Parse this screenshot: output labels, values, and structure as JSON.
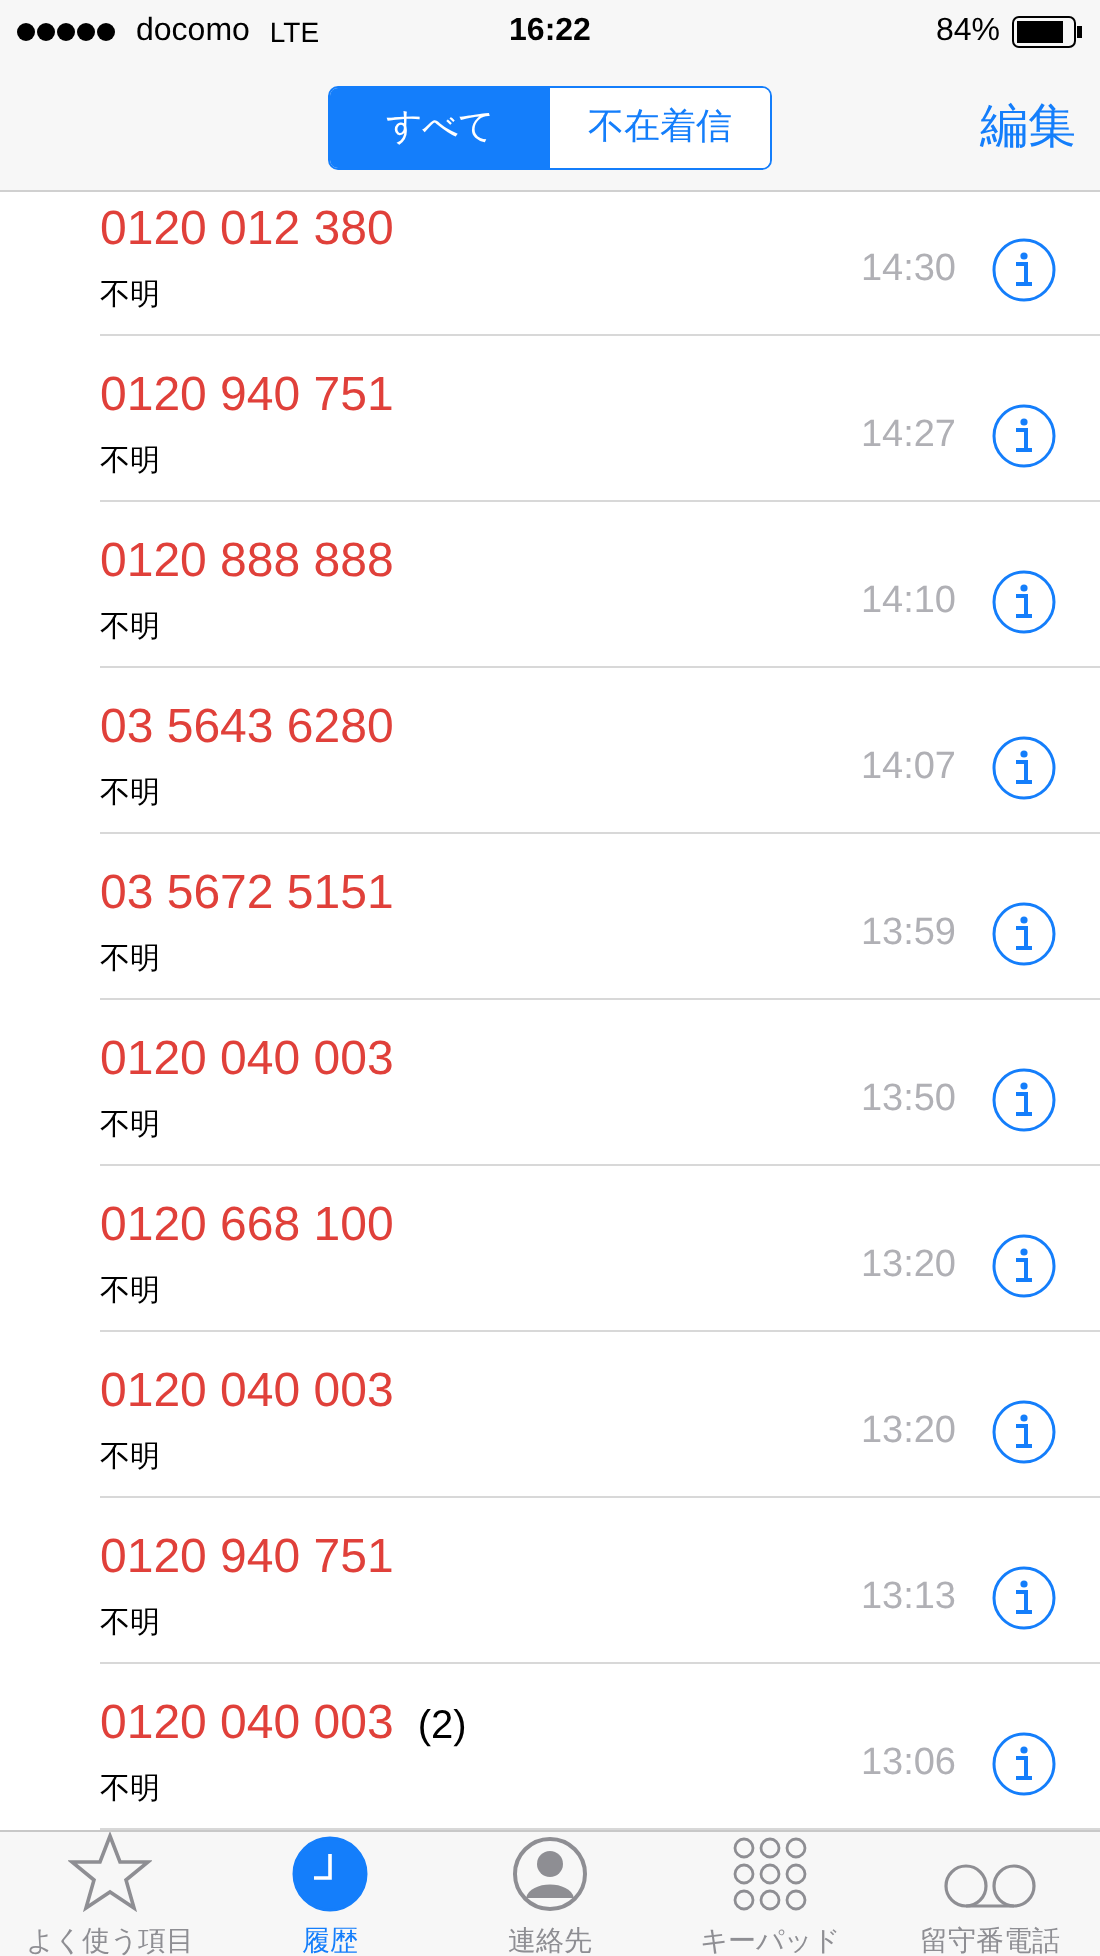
{
  "status_bar": {
    "carrier": "docomo",
    "network": "LTE",
    "time": "16:22",
    "battery_percent": "84%"
  },
  "nav": {
    "segments": [
      {
        "label": "すべて",
        "selected": true
      },
      {
        "label": "不在着信",
        "selected": false
      }
    ],
    "edit": "編集"
  },
  "calls": [
    {
      "number": "0120 012 380",
      "label": "不明",
      "time": "14:30",
      "missed": true
    },
    {
      "number": "0120 940 751",
      "label": "不明",
      "time": "14:27",
      "missed": true
    },
    {
      "number": "0120 888 888",
      "label": "不明",
      "time": "14:10",
      "missed": true
    },
    {
      "number": "03 5643 6280",
      "label": "不明",
      "time": "14:07",
      "missed": true
    },
    {
      "number": "03 5672 5151",
      "label": "不明",
      "time": "13:59",
      "missed": true
    },
    {
      "number": "0120 040 003",
      "label": "不明",
      "time": "13:50",
      "missed": true
    },
    {
      "number": "0120 668 100",
      "label": "不明",
      "time": "13:20",
      "missed": true
    },
    {
      "number": "0120 040 003",
      "label": "不明",
      "time": "13:20",
      "missed": true
    },
    {
      "number": "0120 940 751",
      "label": "不明",
      "time": "13:13",
      "missed": true
    },
    {
      "number": "0120 040 003",
      "count": "(2)",
      "label": "不明",
      "time": "13:06",
      "missed": true
    }
  ],
  "tab_bar": [
    {
      "kind": "star",
      "label": "よく使う項目",
      "selected": false
    },
    {
      "kind": "clock",
      "label": "履歴",
      "selected": true
    },
    {
      "kind": "person",
      "label": "連絡先",
      "selected": false
    },
    {
      "kind": "keypad",
      "label": "キーパッド",
      "selected": false
    },
    {
      "kind": "voicemail",
      "label": "留守番電話",
      "selected": false
    }
  ]
}
